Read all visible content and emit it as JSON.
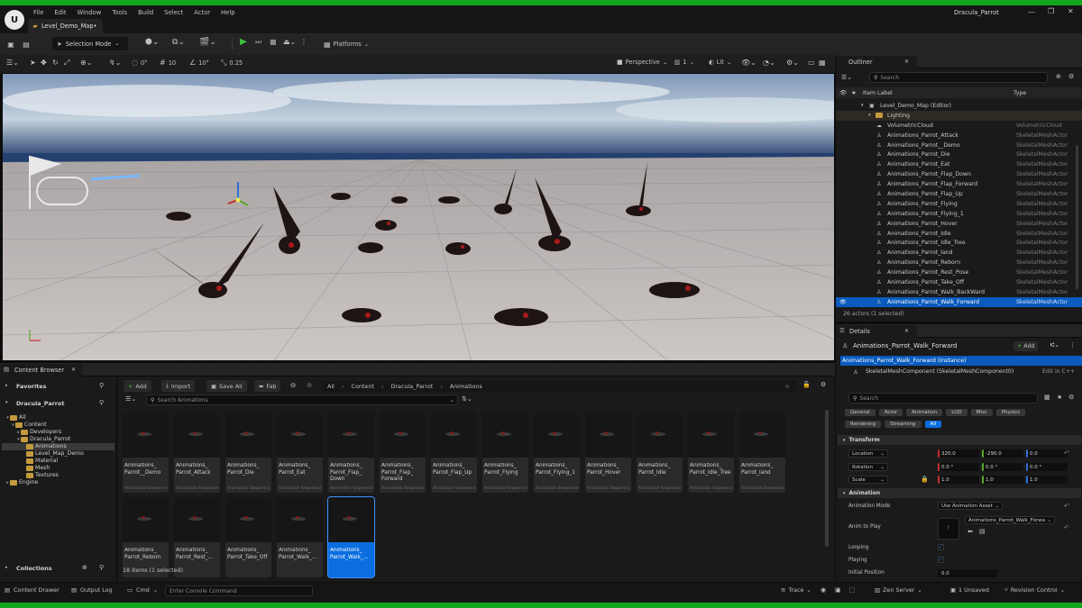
{
  "app": {
    "window_title": "Dracula_Parrot"
  },
  "menu": [
    "File",
    "Edit",
    "Window",
    "Tools",
    "Build",
    "Select",
    "Actor",
    "Help"
  ],
  "level_tab": {
    "label": "Level_Demo_Map•"
  },
  "toolbar": {
    "selection_mode": "Selection Mode",
    "platforms": "Platforms"
  },
  "viewport": {
    "grid_rotation": "0°",
    "grid_size": "10",
    "rotation_snap": "10°",
    "scale_snap": "0.25",
    "camera_speed": "1",
    "perspective": "Perspective",
    "lit": "Lit"
  },
  "outliner": {
    "title": "Outliner",
    "search_placeholder": "Search",
    "col_label": "Item Label",
    "col_type": "Type",
    "root": "Level_Demo_Map (Editor)",
    "lighting": "Lighting",
    "rows": [
      {
        "label": "VolumetricCloud",
        "type": "VolumetricCloud"
      },
      {
        "label": "Animations_Parrot_Attack",
        "type": "SkeletalMeshActor"
      },
      {
        "label": "Animations_Parrot__Demo",
        "type": "SkeletalMeshActor"
      },
      {
        "label": "Animations_Parrot_Die",
        "type": "SkeletalMeshActor"
      },
      {
        "label": "Animations_Parrot_Eat",
        "type": "SkeletalMeshActor"
      },
      {
        "label": "Animations_Parrot_Flap_Down",
        "type": "SkeletalMeshActor"
      },
      {
        "label": "Animations_Parrot_Flap_Forward",
        "type": "SkeletalMeshActor"
      },
      {
        "label": "Animations_Parrot_Flap_Up",
        "type": "SkeletalMeshActor"
      },
      {
        "label": "Animations_Parrot_Flying",
        "type": "SkeletalMeshActor"
      },
      {
        "label": "Animations_Parrot_Flying_1",
        "type": "SkeletalMeshActor"
      },
      {
        "label": "Animations_Parrot_Hover",
        "type": "SkeletalMeshActor"
      },
      {
        "label": "Animations_Parrot_Idle",
        "type": "SkeletalMeshActor"
      },
      {
        "label": "Animations_Parrot_Idle_Tree",
        "type": "SkeletalMeshActor"
      },
      {
        "label": "Animations_Parrot_land",
        "type": "SkeletalMeshActor"
      },
      {
        "label": "Animations_Parrot_Reborn",
        "type": "SkeletalMeshActor"
      },
      {
        "label": "Animations_Parrot_Rest_Pose",
        "type": "SkeletalMeshActor"
      },
      {
        "label": "Animations_Parrot_Take_Off",
        "type": "SkeletalMeshActor"
      },
      {
        "label": "Animations_Parrot_Walk_BackWard",
        "type": "SkeletalMeshActor"
      },
      {
        "label": "Animations_Parrot_Walk_Forward",
        "type": "SkeletalMeshActor"
      }
    ],
    "status": "26 actors (1 selected)"
  },
  "details": {
    "title": "Details",
    "actor_name": "Animations_Parrot_Walk_Forward",
    "add_label": "Add",
    "instance": "Animations_Parrot_Walk_Forward (Instance)",
    "component": "SkeletalMeshComponent (SkeletalMeshComponent0)",
    "edit_cpp": "Edit in C++",
    "search_placeholder": "Search",
    "filter_tabs": [
      "General",
      "Actor",
      "Animation",
      "LOD",
      "Misc",
      "Physics",
      "Rendering",
      "Streaming",
      "All"
    ],
    "transform_header": "Transform",
    "location_label": "Location",
    "rotation_label": "Rotation",
    "scale_label": "Scale",
    "location": [
      "320.0",
      "-290.0",
      "0.0"
    ],
    "rotation": [
      "0.0 °",
      "0.0 °",
      "0.0 °"
    ],
    "scale": [
      "1.0",
      "1.0",
      "1.0"
    ],
    "animation_header": "Animation",
    "anim_mode_label": "Animation Mode",
    "anim_mode_value": "Use Animation Asset",
    "anim_to_play_label": "Anim to Play",
    "anim_to_play_value": "Animations_Parrot_Walk_Forwa",
    "looping_label": "Looping",
    "playing_label": "Playing",
    "initial_pos_label": "Initial Position",
    "initial_pos_value": "0.0"
  },
  "content_browser": {
    "tab": "Content Browser",
    "add": "Add",
    "import": "Import",
    "save_all": "Save All",
    "fab": "Fab",
    "breadcrumb": [
      "All",
      "Content",
      "Dracula_Parrot",
      "Animations"
    ],
    "search_placeholder": "Search Animations",
    "favorites": "Favorites",
    "project": "Dracula_Parrot",
    "collections": "Collections",
    "tree": [
      "All",
      "Content",
      "Developers",
      "Dracula_Parrot",
      "Animations",
      "Level_Map_Demo",
      "Material",
      "Mesh",
      "Textures",
      "Engine"
    ],
    "asset_type": "Animation Sequence",
    "assets": [
      "Animations_\nParrot__Demo",
      "Animations_\nParrot_Attack",
      "Animations_\nParrot_Die",
      "Animations_\nParrot_Eat",
      "Animations_\nParrot_Flap_\nDown",
      "Animations_\nParrot_Flap_\nForward",
      "Animations_\nParrot_Flap_Up",
      "Animations_\nParrot_Flying",
      "Animations_\nParrot_Flying_1",
      "Animations_\nParrot_Hover",
      "Animations_\nParrot_Idle",
      "Animations_\nParrot_Idle_Tree",
      "Animations_\nParrot_land",
      "Animations_\nParrot_Reborn",
      "Animations_\nParrot_Rest_...",
      "Animations_\nParrot_Take_Off",
      "Animations_\nParrot_Walk_...",
      "Animations_\nParrot_Walk_..."
    ],
    "status": "18 items (1 selected)"
  },
  "statusbar": {
    "content_drawer": "Content Drawer",
    "output_log": "Output Log",
    "cmd": "Cmd",
    "console_placeholder": "Enter Console Command",
    "trace": "Trace",
    "zen_server": "Zen Server",
    "unsaved": "1 Unsaved",
    "revision_control": "Revision Control"
  },
  "colors": {
    "accent": "#0a6ee0",
    "top_strip": "#13a520",
    "selection": "#0a6ee0"
  }
}
